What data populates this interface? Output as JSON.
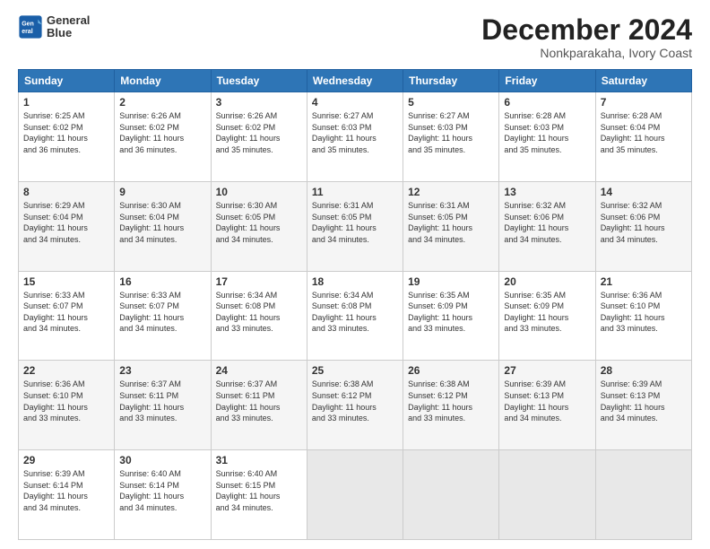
{
  "header": {
    "logo_line1": "General",
    "logo_line2": "Blue",
    "month": "December 2024",
    "location": "Nonkparakaha, Ivory Coast"
  },
  "days_of_week": [
    "Sunday",
    "Monday",
    "Tuesday",
    "Wednesday",
    "Thursday",
    "Friday",
    "Saturday"
  ],
  "weeks": [
    [
      {
        "day": "1",
        "info": "Sunrise: 6:25 AM\nSunset: 6:02 PM\nDaylight: 11 hours\nand 36 minutes."
      },
      {
        "day": "2",
        "info": "Sunrise: 6:26 AM\nSunset: 6:02 PM\nDaylight: 11 hours\nand 36 minutes."
      },
      {
        "day": "3",
        "info": "Sunrise: 6:26 AM\nSunset: 6:02 PM\nDaylight: 11 hours\nand 35 minutes."
      },
      {
        "day": "4",
        "info": "Sunrise: 6:27 AM\nSunset: 6:03 PM\nDaylight: 11 hours\nand 35 minutes."
      },
      {
        "day": "5",
        "info": "Sunrise: 6:27 AM\nSunset: 6:03 PM\nDaylight: 11 hours\nand 35 minutes."
      },
      {
        "day": "6",
        "info": "Sunrise: 6:28 AM\nSunset: 6:03 PM\nDaylight: 11 hours\nand 35 minutes."
      },
      {
        "day": "7",
        "info": "Sunrise: 6:28 AM\nSunset: 6:04 PM\nDaylight: 11 hours\nand 35 minutes."
      }
    ],
    [
      {
        "day": "8",
        "info": "Sunrise: 6:29 AM\nSunset: 6:04 PM\nDaylight: 11 hours\nand 34 minutes."
      },
      {
        "day": "9",
        "info": "Sunrise: 6:30 AM\nSunset: 6:04 PM\nDaylight: 11 hours\nand 34 minutes."
      },
      {
        "day": "10",
        "info": "Sunrise: 6:30 AM\nSunset: 6:05 PM\nDaylight: 11 hours\nand 34 minutes."
      },
      {
        "day": "11",
        "info": "Sunrise: 6:31 AM\nSunset: 6:05 PM\nDaylight: 11 hours\nand 34 minutes."
      },
      {
        "day": "12",
        "info": "Sunrise: 6:31 AM\nSunset: 6:05 PM\nDaylight: 11 hours\nand 34 minutes."
      },
      {
        "day": "13",
        "info": "Sunrise: 6:32 AM\nSunset: 6:06 PM\nDaylight: 11 hours\nand 34 minutes."
      },
      {
        "day": "14",
        "info": "Sunrise: 6:32 AM\nSunset: 6:06 PM\nDaylight: 11 hours\nand 34 minutes."
      }
    ],
    [
      {
        "day": "15",
        "info": "Sunrise: 6:33 AM\nSunset: 6:07 PM\nDaylight: 11 hours\nand 34 minutes."
      },
      {
        "day": "16",
        "info": "Sunrise: 6:33 AM\nSunset: 6:07 PM\nDaylight: 11 hours\nand 34 minutes."
      },
      {
        "day": "17",
        "info": "Sunrise: 6:34 AM\nSunset: 6:08 PM\nDaylight: 11 hours\nand 33 minutes."
      },
      {
        "day": "18",
        "info": "Sunrise: 6:34 AM\nSunset: 6:08 PM\nDaylight: 11 hours\nand 33 minutes."
      },
      {
        "day": "19",
        "info": "Sunrise: 6:35 AM\nSunset: 6:09 PM\nDaylight: 11 hours\nand 33 minutes."
      },
      {
        "day": "20",
        "info": "Sunrise: 6:35 AM\nSunset: 6:09 PM\nDaylight: 11 hours\nand 33 minutes."
      },
      {
        "day": "21",
        "info": "Sunrise: 6:36 AM\nSunset: 6:10 PM\nDaylight: 11 hours\nand 33 minutes."
      }
    ],
    [
      {
        "day": "22",
        "info": "Sunrise: 6:36 AM\nSunset: 6:10 PM\nDaylight: 11 hours\nand 33 minutes."
      },
      {
        "day": "23",
        "info": "Sunrise: 6:37 AM\nSunset: 6:11 PM\nDaylight: 11 hours\nand 33 minutes."
      },
      {
        "day": "24",
        "info": "Sunrise: 6:37 AM\nSunset: 6:11 PM\nDaylight: 11 hours\nand 33 minutes."
      },
      {
        "day": "25",
        "info": "Sunrise: 6:38 AM\nSunset: 6:12 PM\nDaylight: 11 hours\nand 33 minutes."
      },
      {
        "day": "26",
        "info": "Sunrise: 6:38 AM\nSunset: 6:12 PM\nDaylight: 11 hours\nand 33 minutes."
      },
      {
        "day": "27",
        "info": "Sunrise: 6:39 AM\nSunset: 6:13 PM\nDaylight: 11 hours\nand 34 minutes."
      },
      {
        "day": "28",
        "info": "Sunrise: 6:39 AM\nSunset: 6:13 PM\nDaylight: 11 hours\nand 34 minutes."
      }
    ],
    [
      {
        "day": "29",
        "info": "Sunrise: 6:39 AM\nSunset: 6:14 PM\nDaylight: 11 hours\nand 34 minutes."
      },
      {
        "day": "30",
        "info": "Sunrise: 6:40 AM\nSunset: 6:14 PM\nDaylight: 11 hours\nand 34 minutes."
      },
      {
        "day": "31",
        "info": "Sunrise: 6:40 AM\nSunset: 6:15 PM\nDaylight: 11 hours\nand 34 minutes."
      },
      null,
      null,
      null,
      null
    ]
  ]
}
